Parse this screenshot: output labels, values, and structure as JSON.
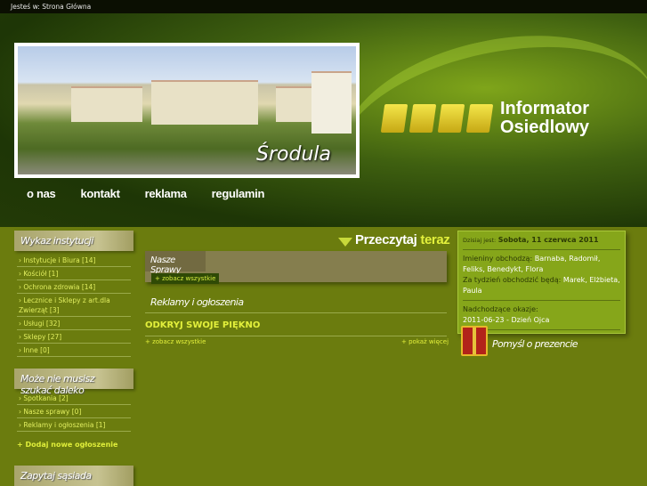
{
  "topbar": {
    "breadcrumb": "Jesteś w: Strona Główna"
  },
  "header": {
    "photo_label": "Środula",
    "logo_line1": "Informator",
    "logo_line2": "Osiedlowy"
  },
  "nav": [
    "o nas",
    "kontakt",
    "reklama",
    "regulamin"
  ],
  "sidebar": {
    "institutions": {
      "title": "Wykaz instytucji",
      "items": [
        "Instytucje i Biura [14]",
        "Kościół [1]",
        "Ochrona zdrowia [14]",
        "Lecznice i Sklepy z art.dla Zwierząt [3]",
        "Usługi [32]",
        "Sklepy [27]",
        "Inne [0]"
      ]
    },
    "nearby": {
      "title": "Może nie musisz szukać daleko",
      "items": [
        "Spotkania [2]",
        "Nasze sprawy [0]",
        "Reklamy i ogłoszenia [1]"
      ],
      "add": "+ Dodaj nowe ogłoszenie"
    },
    "ask": {
      "title": "Zapytaj sąsiada"
    }
  },
  "main": {
    "read_now": "Przeczytaj",
    "read_now_accent": "teraz",
    "nasze_sprawy": "Nasze Sprawy",
    "see_all": "+ zobacz wszystkie",
    "ads_title": "Reklamy i ogłoszenia",
    "ad_item": "ODKRYJ SWOJE PIĘKNO",
    "ads_see_all": "+ zobacz wszystkie",
    "ads_more": "+ pokaż więcej"
  },
  "info": {
    "today_label": "Dzisiaj jest:",
    "today": "Sobota, 11 czerwca 2011",
    "names_label": "Imieniny obchodzą:",
    "names": "Barnaba, Radomił, Feliks, Benedykt, Flora",
    "week_label": "Za tydzień obchodzić będą:",
    "week": "Marek, Elżbieta, Paula",
    "upcoming_label": "Nadchodzące okazje:",
    "upcoming": "2011-06-23 - Dzień Ojca",
    "gift": "Pomyśl o prezencie"
  }
}
